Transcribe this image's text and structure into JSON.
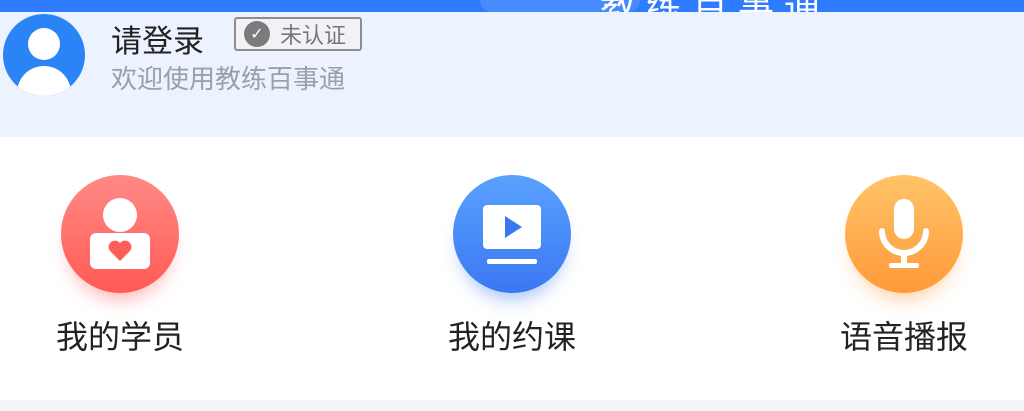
{
  "banner": {
    "text": "教练百事通"
  },
  "profile": {
    "title": "请登录",
    "badge": "未认证",
    "subtitle": "欢迎使用教练百事通"
  },
  "features": [
    {
      "label": "我的学员",
      "icon": "student-heart-icon",
      "color": "#ff6b66"
    },
    {
      "label": "我的约课",
      "icon": "video-play-icon",
      "color": "#4a8cfa"
    },
    {
      "label": "语音播报",
      "icon": "microphone-icon",
      "color": "#ffae4d"
    }
  ]
}
